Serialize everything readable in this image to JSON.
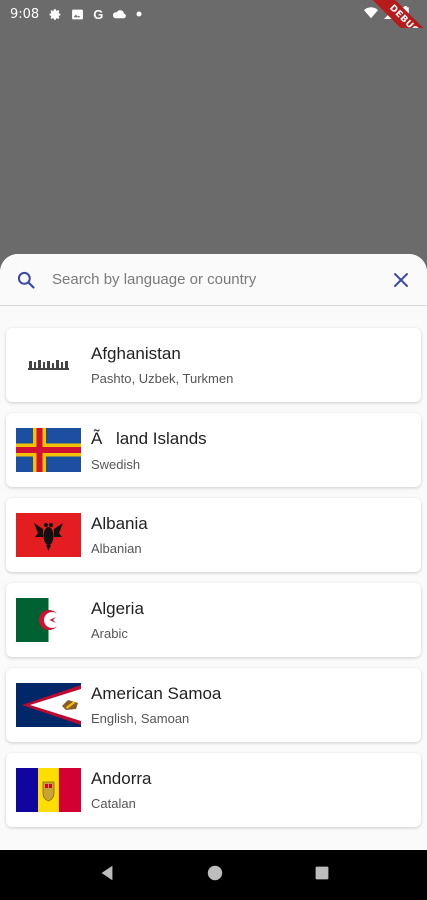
{
  "status_bar": {
    "time": "9:08",
    "icons": [
      "gear-icon",
      "image-icon",
      "google-icon",
      "cloud-icon",
      "dot-icon"
    ],
    "right_icons": [
      "wifi-icon",
      "signal-icon",
      "battery-icon"
    ]
  },
  "debug_banner": "DEBUG",
  "search": {
    "placeholder": "Search by language or country",
    "value": ""
  },
  "countries": [
    {
      "name": "Afghanistan",
      "languages": "Pashto, Uzbek, Turkmen",
      "flag": "afghanistan-flag"
    },
    {
      "name": "Ãland Islands",
      "languages": "Swedish",
      "flag": "aland-islands-flag"
    },
    {
      "name": "Albania",
      "languages": "Albanian",
      "flag": "albania-flag"
    },
    {
      "name": "Algeria",
      "languages": "Arabic",
      "flag": "algeria-flag"
    },
    {
      "name": "American Samoa",
      "languages": "English, Samoan",
      "flag": "american-samoa-flag"
    },
    {
      "name": "Andorra",
      "languages": "Catalan",
      "flag": "andorra-flag"
    }
  ],
  "colors": {
    "accent": "#3949ab",
    "scrim": "#6b6b6b",
    "sheet": "#fafafa"
  }
}
